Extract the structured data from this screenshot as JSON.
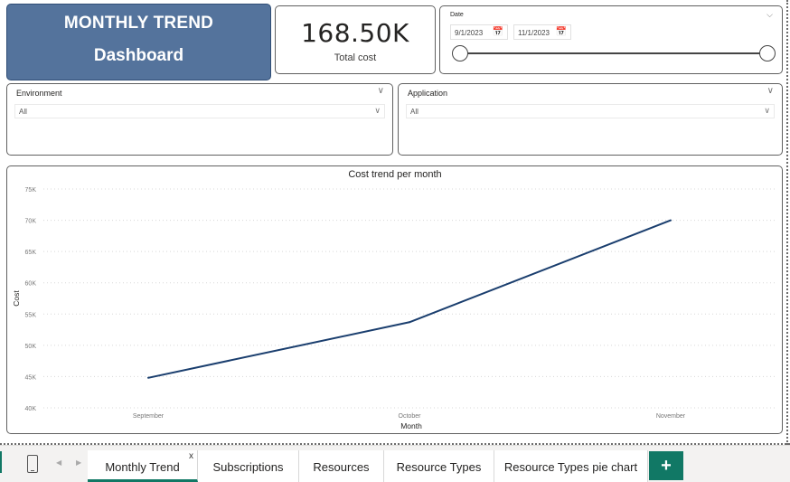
{
  "header": {
    "title_line1": "MONTHLY TREND",
    "title_line2": "Dashboard"
  },
  "kpi": {
    "value": "168.50K",
    "label": "Total cost"
  },
  "date_slicer": {
    "label": "Date",
    "start": "9/1/2023",
    "end": "11/1/2023",
    "range_fraction": [
      0,
      1
    ]
  },
  "slicers": [
    {
      "title": "Environment",
      "selected": "All"
    },
    {
      "title": "Application",
      "selected": "All"
    }
  ],
  "chart_data": {
    "type": "line",
    "title": "Cost trend per month",
    "xlabel": "Month",
    "ylabel": "Cost",
    "categories": [
      "September",
      "October",
      "November"
    ],
    "series": [
      {
        "values": [
          44800,
          53700,
          70000
        ],
        "color": "#1a3e6e"
      }
    ],
    "yticks": [
      "40K",
      "45K",
      "50K",
      "55K",
      "60K",
      "65K",
      "70K",
      "75K"
    ],
    "ylim": [
      40000,
      75000
    ],
    "grid": true,
    "legend": "none"
  },
  "tabs": [
    {
      "label": "Monthly Trend",
      "active": true,
      "close": "x"
    },
    {
      "label": "Subscriptions"
    },
    {
      "label": "Resources"
    },
    {
      "label": "Resource Types"
    },
    {
      "label": "Resource Types pie chart"
    }
  ],
  "add_tab": "+",
  "icons": {
    "calendar": "calendar-icon",
    "chevron": "chevron-down-icon",
    "phone": "phone-layout-icon",
    "prev": "prev-page-icon",
    "next": "next-page-icon"
  },
  "colors": {
    "title_bg": "#54739c",
    "line": "#1a3e6e",
    "accent": "#117865"
  }
}
